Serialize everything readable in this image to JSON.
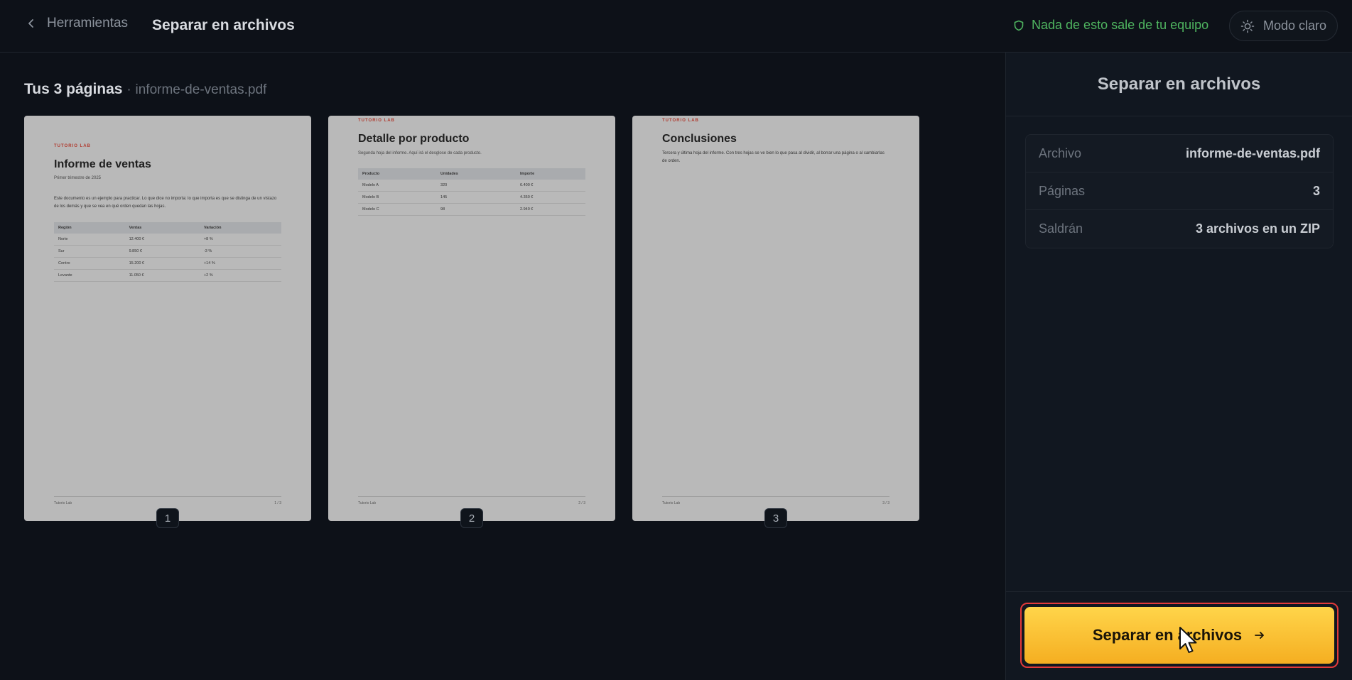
{
  "header": {
    "back_label": "Herramientas",
    "title": "Separar en archivos",
    "privacy_text": "Nada de esto sale de tu equipo",
    "theme_label": "Modo claro"
  },
  "main": {
    "pages_label": "Tus 3 páginas",
    "separator": "·",
    "file_name": "informe-de-ventas.pdf"
  },
  "pages": [
    {
      "number": "1",
      "tag": "TUTORIO LAB",
      "title": "Informe de ventas",
      "subtitle": "Primer trimestre de 2025",
      "paragraph": "Este documento es un ejemplo para practicar. Lo que dice no importa: lo que importa es que se distinga de un vistazo de los demás y que se vea en qué orden quedan las hojas.",
      "headers": [
        "Región",
        "Ventas",
        "Variación"
      ],
      "rows": [
        [
          "Norte",
          "12.400 €",
          "+8 %"
        ],
        [
          "Sur",
          "9.850 €",
          "-3 %"
        ],
        [
          "Centro",
          "15.200 €",
          "+14 %"
        ],
        [
          "Levante",
          "11.050 €",
          "+2 %"
        ]
      ],
      "footer_left": "Tutorio Lab",
      "footer_right": "1 / 3"
    },
    {
      "number": "2",
      "tag": "TUTORIO LAB",
      "title": "Detalle por producto",
      "subtitle": "Segunda hoja del informe. Aquí irá el desglose de cada producto.",
      "headers": [
        "Producto",
        "Unidades",
        "Importe"
      ],
      "rows": [
        [
          "Modelo A",
          "320",
          "6.400 €"
        ],
        [
          "Modelo B",
          "145",
          "4.350 €"
        ],
        [
          "Modelo C",
          "98",
          "2.940 €"
        ]
      ],
      "footer_left": "Tutorio Lab",
      "footer_right": "2 / 3"
    },
    {
      "number": "3",
      "tag": "TUTORIO LAB",
      "title": "Conclusiones",
      "subtitle": "Tercera y última hoja del informe. Con tres hojas se ve bien lo que pasa al dividir, al borrar una página o al cambiarlas de orden.",
      "footer_left": "Tutorio Lab",
      "footer_right": "3 / 3"
    }
  ],
  "panel": {
    "title": "Separar en archivos",
    "info": [
      {
        "key": "Archivo",
        "value": "informe-de-ventas.pdf"
      },
      {
        "key": "Páginas",
        "value": "3"
      },
      {
        "key": "Saldrán",
        "value": "3 archivos en un ZIP"
      }
    ],
    "action_label": "Separar en archivos"
  },
  "colors": {
    "background": "#0d1118",
    "accent": "#f5ae21",
    "privacy": "#4fb560",
    "focus_outline": "#e23a3a"
  },
  "icons": {
    "back": "chevron-left-icon",
    "privacy": "shield-icon",
    "theme": "sun-icon",
    "action": "arrow-right-icon"
  }
}
